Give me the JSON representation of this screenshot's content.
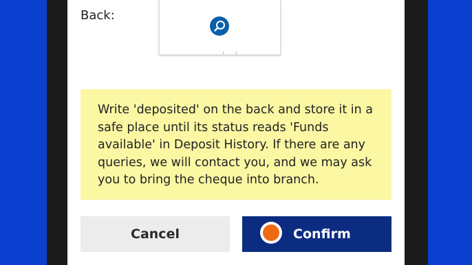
{
  "back_section": {
    "label": "Back:",
    "zoom_icon": "zoom-in-icon"
  },
  "notice": {
    "text": "Write 'deposited' on the back and store it in a safe place until its status reads 'Funds available' in Deposit History. If there are any queries, we will contact you, and we may ask you to bring the cheque into branch.",
    "background": "#fbf7a3"
  },
  "actions": {
    "cancel_label": "Cancel",
    "confirm_label": "Confirm",
    "confirm_icon": "loading-indicator-icon"
  },
  "colors": {
    "page_background": "#0a3fcf",
    "confirm_button": "#0c2c82",
    "cancel_button": "#ececec",
    "accent_orange": "#f06a14",
    "zoom_button": "#0b5fa8"
  }
}
